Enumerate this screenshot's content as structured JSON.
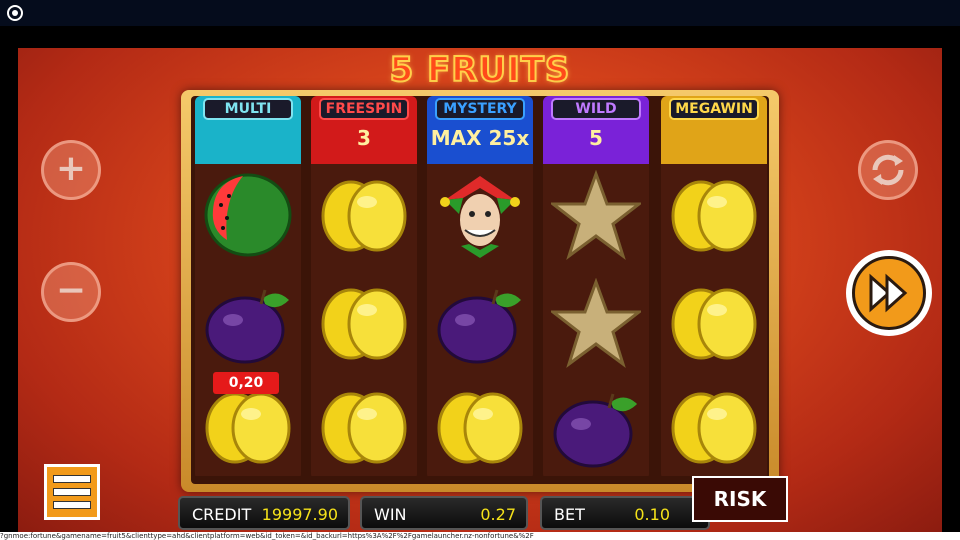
{
  "title": "5 FRUITS",
  "reels": [
    {
      "label": "MULTI",
      "value": "",
      "label_color": "#7fe4f0",
      "head_color": "#1ab3c9",
      "symbols": [
        "watermelon-icon",
        "plum-icon",
        "lemon-icon"
      ]
    },
    {
      "label": "FREESPIN",
      "value": "3",
      "label_color": "#ff4a4a",
      "head_color": "#d21a1a",
      "symbols": [
        "lemon-icon",
        "lemon-icon",
        "lemon-icon"
      ]
    },
    {
      "label": "MYSTERY",
      "value": "MAX 25x",
      "label_color": "#3aa0ff",
      "head_color": "#1a4fd0",
      "symbols": [
        "joker-icon",
        "plum-icon",
        "lemon-icon"
      ]
    },
    {
      "label": "WILD",
      "value": "5",
      "label_color": "#c07aff",
      "head_color": "#7a22d8",
      "symbols": [
        "star-icon",
        "star-icon",
        "plum-icon"
      ]
    },
    {
      "label": "MEGAWIN",
      "value": "",
      "label_color": "#ffd84a",
      "head_color": "#e0a418",
      "symbols": [
        "lemon-icon",
        "lemon-icon",
        "lemon-icon"
      ]
    }
  ],
  "win_tag": "0,20",
  "controls": {
    "plus": "+",
    "minus": "−"
  },
  "panels": {
    "credit_label": "CREDIT",
    "credit_value": "19997.90",
    "win_label": "WIN",
    "win_value": "0.27",
    "bet_label": "BET",
    "bet_value": "0.10"
  },
  "risk_label": "RISK",
  "status_text": "?gnmoe:fortune&gamename=fruit5&clienttype=ahd&clientplatform=web&id_token=&id_backurl=https%3A%2F%2Fgamelauncher.nz-nonfortune&%2F"
}
